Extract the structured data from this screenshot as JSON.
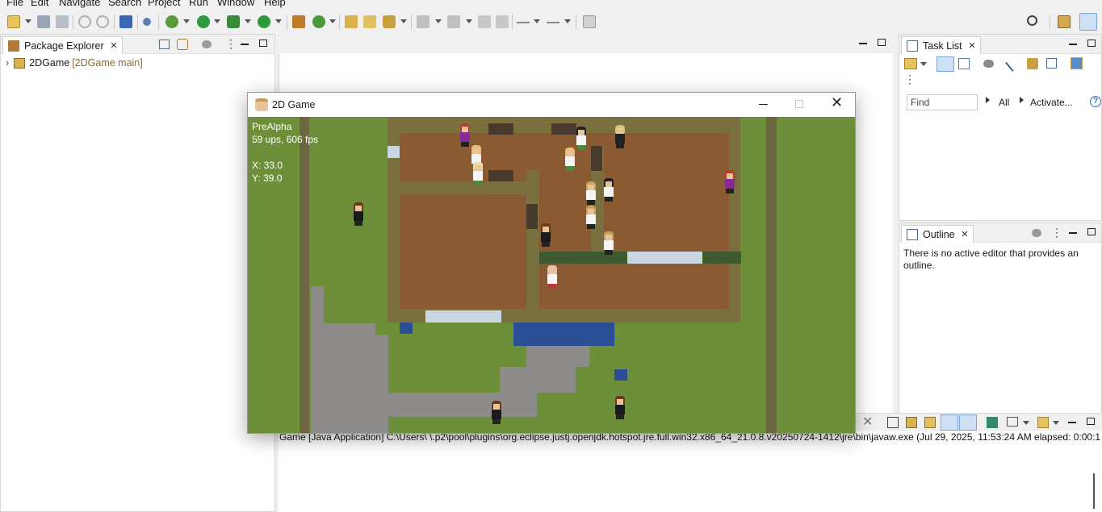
{
  "menu": {
    "items": [
      {
        "label": "File"
      },
      {
        "label": "Edit"
      },
      {
        "label": "Navigate"
      },
      {
        "label": "Search"
      },
      {
        "label": "Project"
      },
      {
        "label": "Run"
      },
      {
        "label": "Window"
      },
      {
        "label": "Help"
      }
    ]
  },
  "package_explorer": {
    "tab_label": "Package Explorer",
    "project_name": "2DGame",
    "project_branch": "[2DGame main]"
  },
  "task_list": {
    "tab_label": "Task List",
    "find_placeholder": "Find",
    "filter_all": "All",
    "filter_activate": "Activate..."
  },
  "outline": {
    "tab_label": "Outline",
    "empty_message": "There is no active editor that provides an outline."
  },
  "game_window": {
    "title": "2D Game",
    "hud": {
      "version": "PreAlpha",
      "perf": "59 ups, 606 fps",
      "x": "X: 33.0",
      "y": "Y: 39.0"
    }
  },
  "console": {
    "status_line": "Game [Java Application] C:\\Users\\        \\.p2\\pool\\plugins\\org.eclipse.justj.openjdk.hotspot.jre.full.win32.x86_64_21.0.8.v20250724-1412\\jre\\bin\\javaw.exe  (Jul 29, 2025, 11:53:24 AM elapsed: 0:00:1"
  },
  "colors": {
    "grass": "#6e8f3a",
    "floor": "#8a5a32",
    "wall": "#7a6f3e",
    "stone": "#8e8c8a",
    "water": "#2b4f94",
    "ice": "#c9d7e3",
    "accent_blue": "#2a6ecf"
  }
}
